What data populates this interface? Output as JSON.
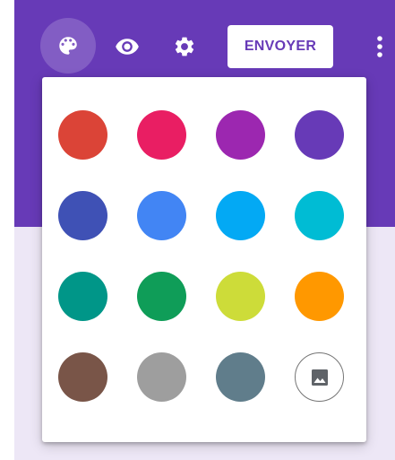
{
  "toolbar": {
    "send_label": "ENVOYER"
  },
  "theme": {
    "primary": "#673ab7",
    "background": "#ede7f6"
  },
  "palette": {
    "colors": [
      "#db4437",
      "#e91e63",
      "#9c27b0",
      "#673ab7",
      "#3f51b5",
      "#4285f4",
      "#03a9f4",
      "#00bcd4",
      "#009688",
      "#0f9d58",
      "#cddc39",
      "#ff9800",
      "#795548",
      "#9e9e9e",
      "#607d8b"
    ],
    "custom_image_icon": "image-icon"
  }
}
